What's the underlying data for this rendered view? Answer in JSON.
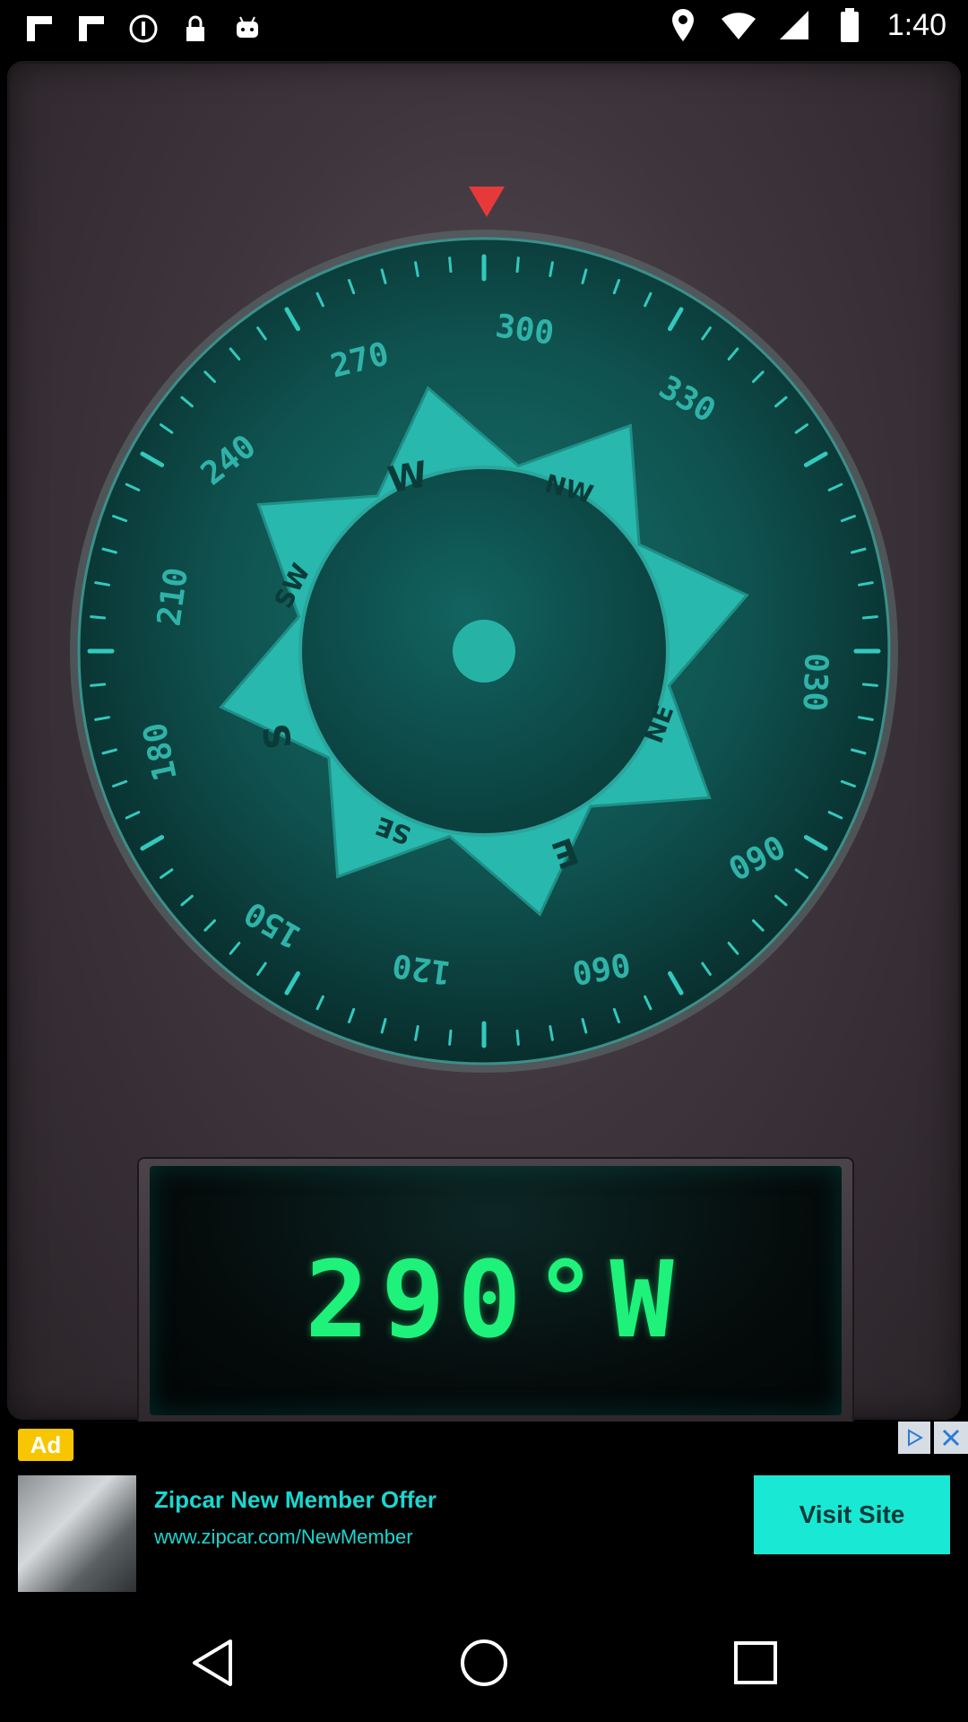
{
  "status_bar": {
    "time": "1:40",
    "left_icons": [
      "flipboard-icon",
      "flipboard-icon",
      "info-icon",
      "lock-icon",
      "android-icon"
    ],
    "right_icons": [
      "location-icon",
      "wifi-icon",
      "signal-icon",
      "battery-icon"
    ]
  },
  "compass": {
    "heading_deg": 290,
    "dial_labels": [
      "300",
      "330",
      "030",
      "060",
      "090",
      "120",
      "150",
      "180",
      "210",
      "240",
      "270"
    ],
    "cardinal_labels": [
      "W",
      "NW",
      "SW",
      "S",
      "NE",
      "SE",
      "E"
    ],
    "colors": {
      "dial": "#0e4a48",
      "rose": "#28b8ad",
      "accent": "#e63a3a"
    }
  },
  "readout": {
    "text": "290°W"
  },
  "ad": {
    "badge": "Ad",
    "title": "Zipcar New Member Offer",
    "url": "www.zipcar.com/NewMember",
    "cta": "Visit Site"
  },
  "navbar": {
    "buttons": [
      "back-icon",
      "home-icon",
      "recents-icon"
    ]
  }
}
